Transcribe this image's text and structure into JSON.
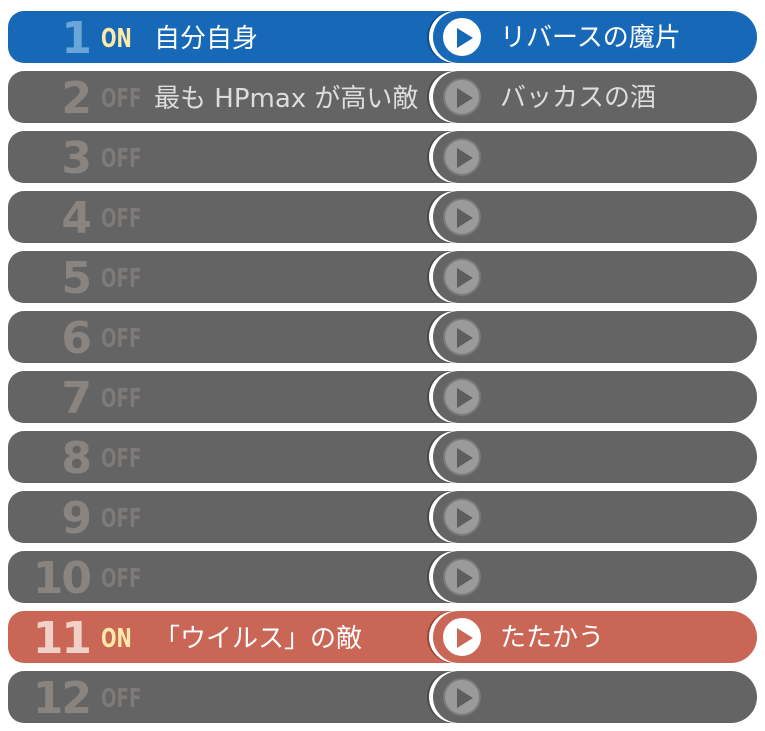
{
  "rules": [
    {
      "number": "1",
      "state": "ON",
      "target": "自分自身",
      "action": "リバースの魔片",
      "active": "blue"
    },
    {
      "number": "2",
      "state": "OFF",
      "target": "最も HPmax が高い敵",
      "action": "バッカスの酒",
      "active": ""
    },
    {
      "number": "3",
      "state": "OFF",
      "target": "",
      "action": "",
      "active": ""
    },
    {
      "number": "4",
      "state": "OFF",
      "target": "",
      "action": "",
      "active": ""
    },
    {
      "number": "5",
      "state": "OFF",
      "target": "",
      "action": "",
      "active": ""
    },
    {
      "number": "6",
      "state": "OFF",
      "target": "",
      "action": "",
      "active": ""
    },
    {
      "number": "7",
      "state": "OFF",
      "target": "",
      "action": "",
      "active": ""
    },
    {
      "number": "8",
      "state": "OFF",
      "target": "",
      "action": "",
      "active": ""
    },
    {
      "number": "9",
      "state": "OFF",
      "target": "",
      "action": "",
      "active": ""
    },
    {
      "number": "10",
      "state": "OFF",
      "target": "",
      "action": "",
      "active": ""
    },
    {
      "number": "11",
      "state": "ON",
      "target": "「ウイルス」の敵",
      "action": "たたかう",
      "active": "red"
    },
    {
      "number": "12",
      "state": "OFF",
      "target": "",
      "action": "",
      "active": ""
    }
  ],
  "icons": {
    "action_icon": "play-icon"
  },
  "colors": {
    "active_blue": "#1769b8",
    "active_red": "#c96655",
    "inactive": "#646464",
    "on_text": "#ffe9a8"
  }
}
